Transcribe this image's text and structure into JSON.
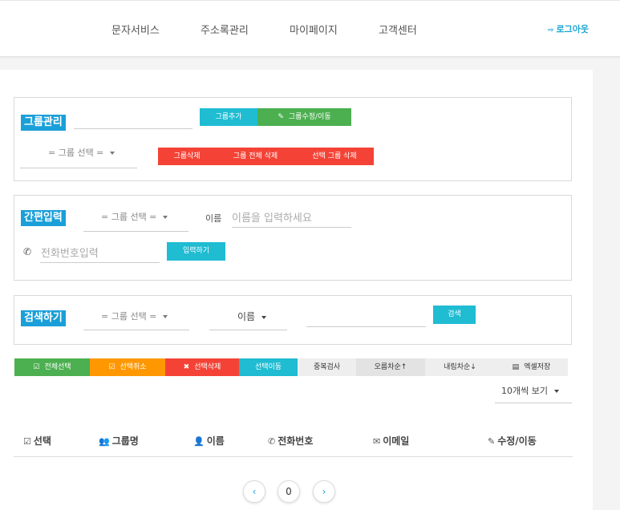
{
  "nav": {
    "items": [
      "문자서비스",
      "주소록관리",
      "마이페이지",
      "고객센터"
    ],
    "logout_label": "로그아웃"
  },
  "group_mgmt": {
    "title": "그룹관리",
    "add_label": "그룹추가",
    "edit_label": "그룹수정/이동",
    "select_label": "= 그룹 선택 =",
    "delete_label": "그룹삭제",
    "delete_all_label": "그룹 전체 삭제",
    "delete_selected_label": "선택 그룹 삭제"
  },
  "quick_input": {
    "title": "간편입력",
    "select_label": "= 그룹 선택 =",
    "name_label": "이름",
    "name_placeholder": "이름을 입력하세요",
    "phone_placeholder": "전화번호입력",
    "submit_label": "입력하기"
  },
  "search": {
    "title": "검색하기",
    "select_label": "= 그룹 선택 =",
    "field_label": "이름",
    "button_label": "검색"
  },
  "actions": {
    "select_all": "전체선택",
    "deselect": "선택취소",
    "delete_selected": "선택삭제",
    "move_selected": "선택이동",
    "dup_check": "중복검사",
    "sort_asc": "오름차순",
    "sort_desc": "내림차순",
    "excel_save": "엑셀저장"
  },
  "page_size": "10개씩 보기",
  "table": {
    "headers": [
      "선택",
      "그룹명",
      "이름",
      "전화번호",
      "이메일",
      "수정/이동"
    ]
  },
  "pagination": {
    "prev": "‹",
    "current": "0",
    "next": "›"
  },
  "colors": {
    "accent": "#1a9fd9",
    "cyan": "#1fbcd2",
    "green": "#4caf50",
    "red": "#f44336",
    "orange": "#ff9800"
  }
}
